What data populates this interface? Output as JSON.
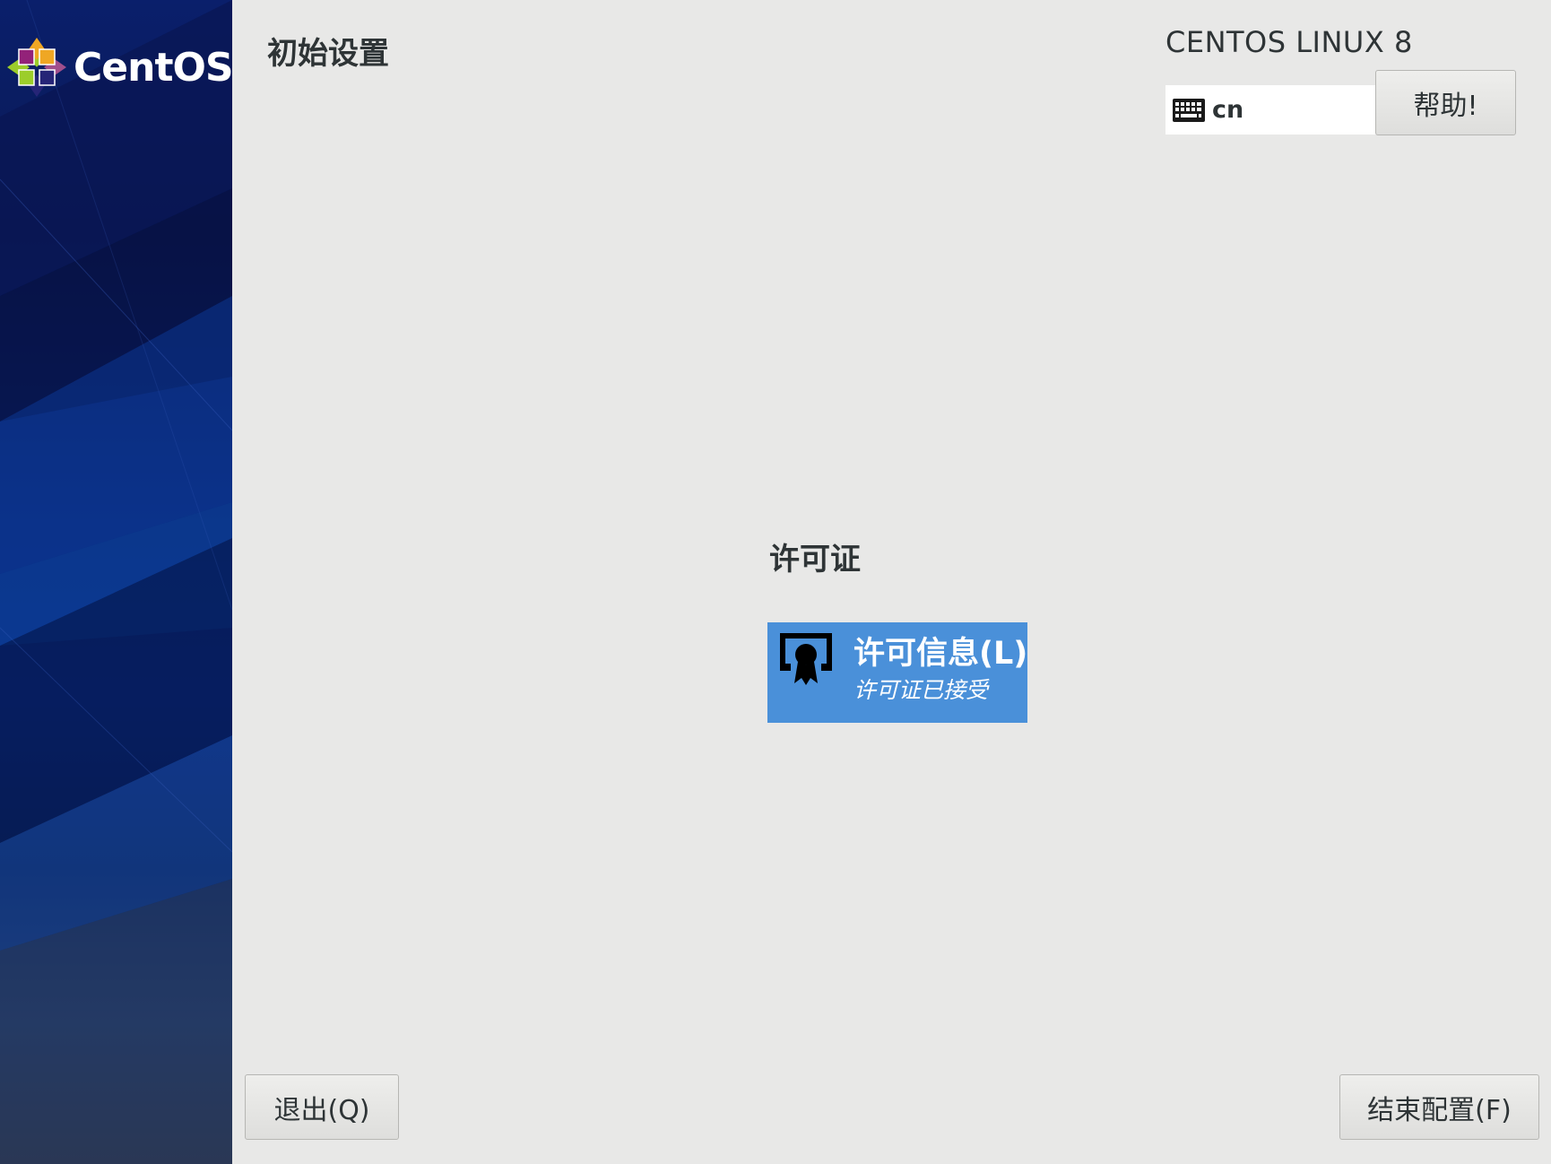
{
  "sidebar": {
    "logo_text": "CentOS"
  },
  "header": {
    "page_title": "初始设置",
    "product_name": "CENTOS LINUX 8",
    "keyboard_layout": "cn",
    "help_label": "帮助!"
  },
  "main": {
    "section_title": "许可证",
    "spoke": {
      "title": "许可信息(L)",
      "status": "许可证已接受",
      "icon": "license-icon"
    }
  },
  "footer": {
    "quit_label": "退出(Q)",
    "finish_label": "结束配置(F)"
  },
  "colors": {
    "sidebar_blue": "#0a2e86",
    "spoke_selected": "#4a90d9",
    "background": "#e8e8e7"
  }
}
